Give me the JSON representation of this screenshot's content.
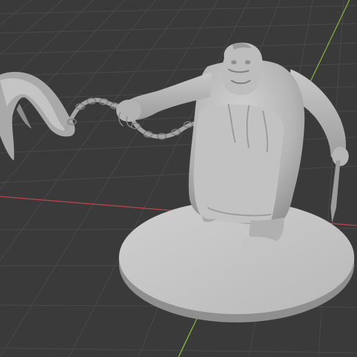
{
  "viewport": {
    "description_hidden": "",
    "background_color": "#3a3a3a",
    "grid_color": "#4a4a4a",
    "axis_x_color": "#c0444c",
    "axis_y_color": "#86b53c",
    "model_color": "#b8b8b8",
    "model_shadow_color": "#8a8a8a"
  }
}
